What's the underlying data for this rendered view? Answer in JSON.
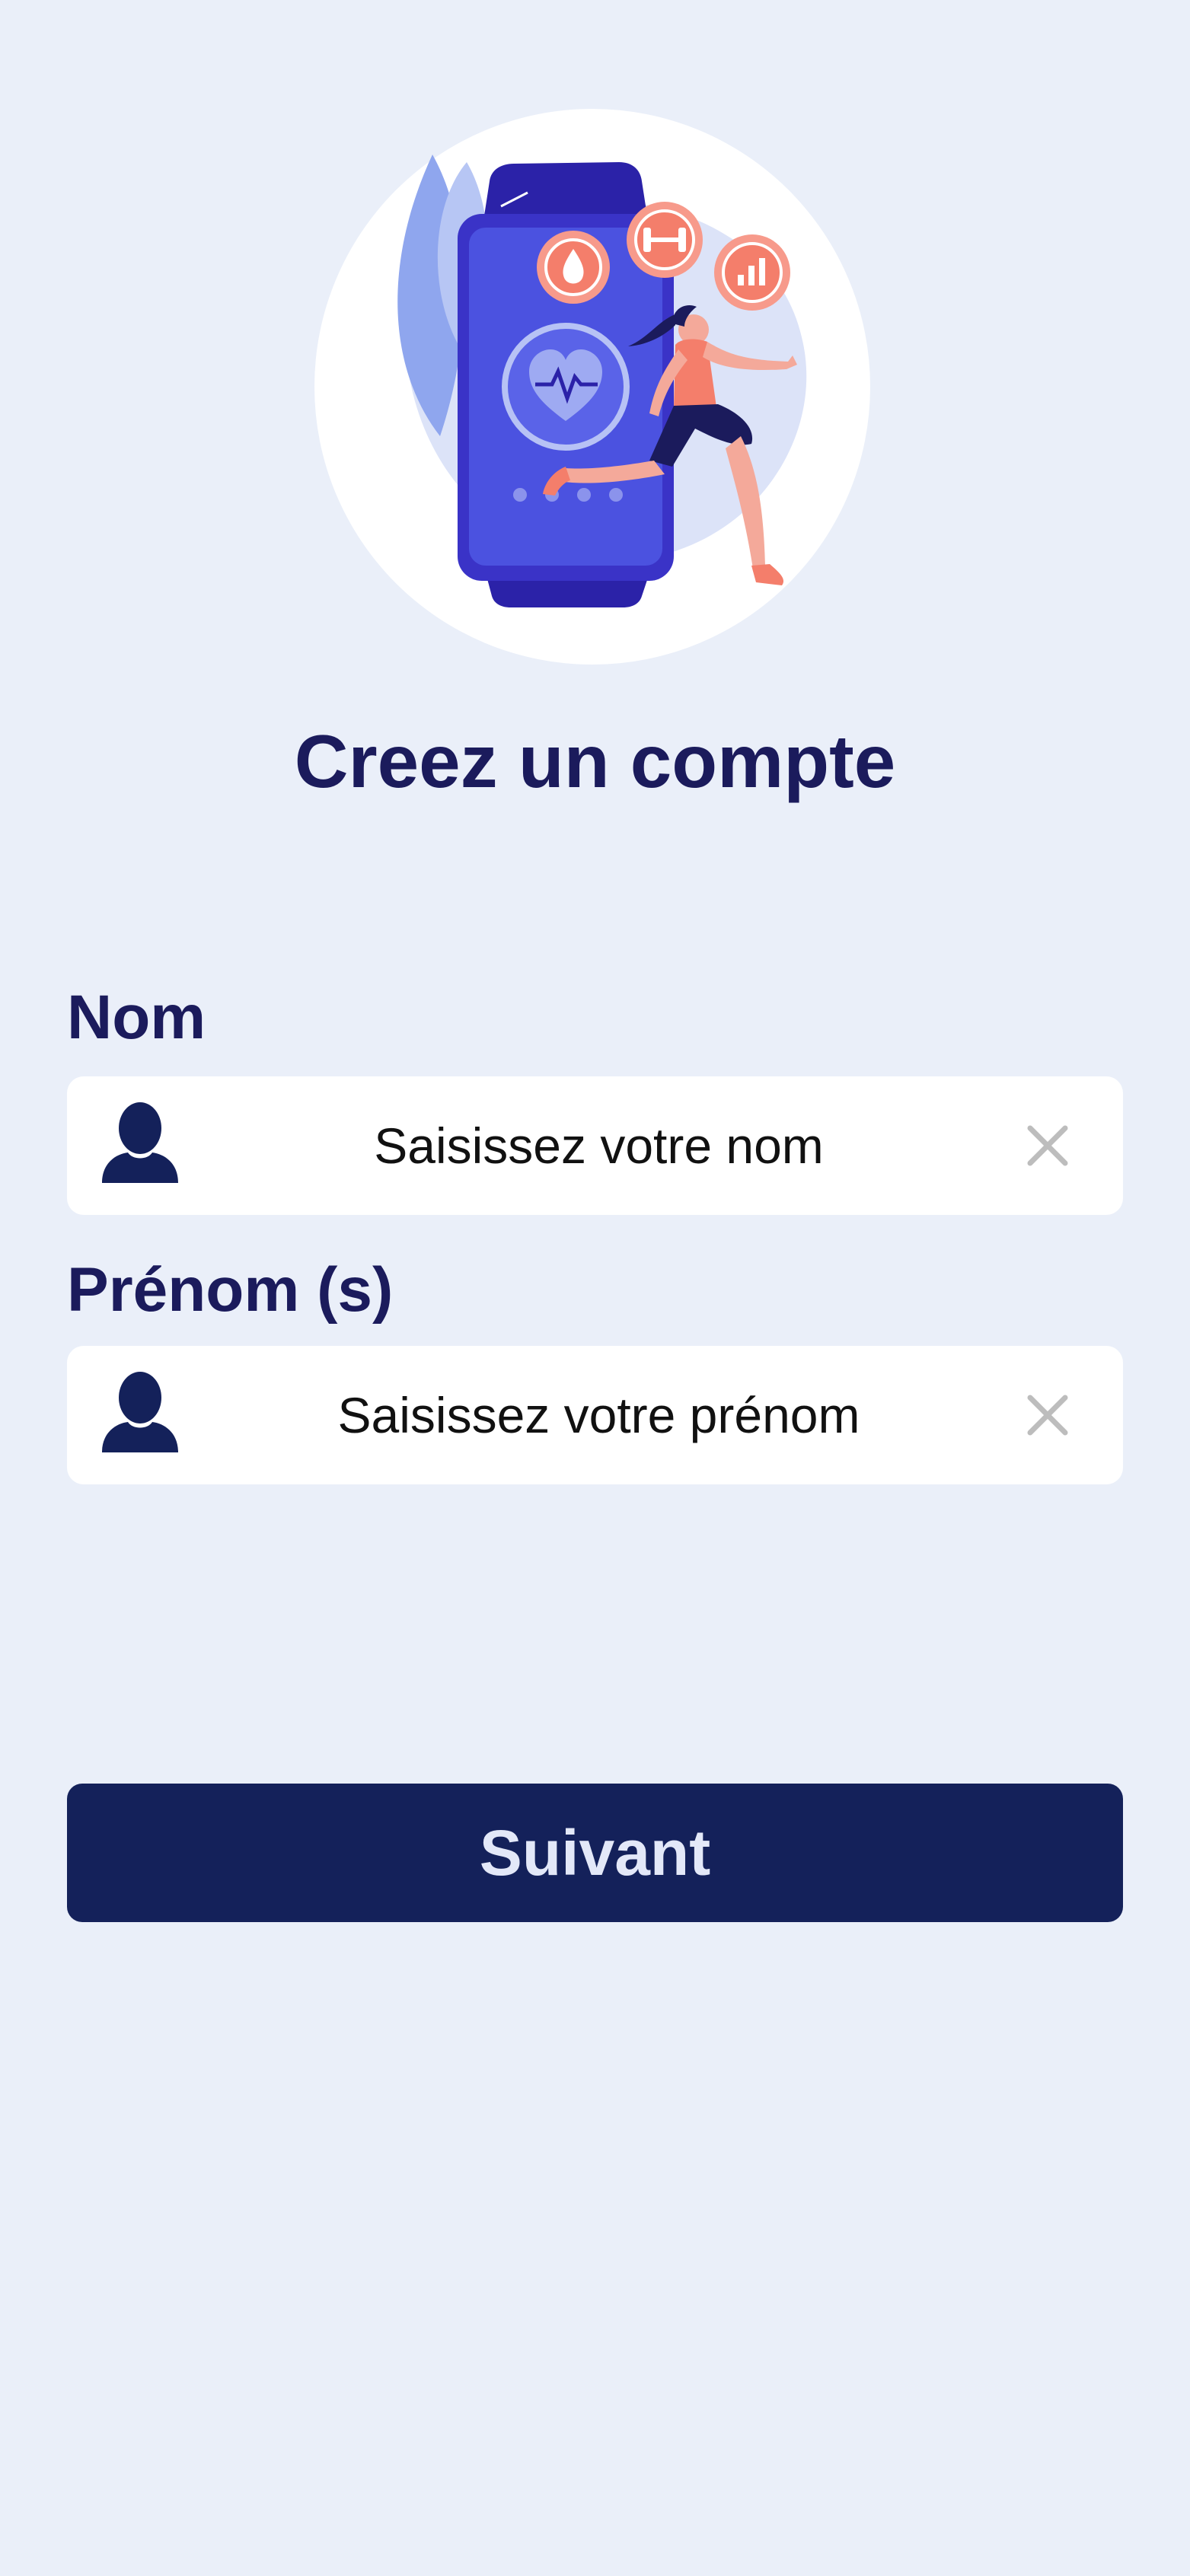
{
  "header": {
    "title": "Creez un compte"
  },
  "hero": {
    "illustration": "smartwatch-fitness-illustration"
  },
  "form": {
    "nom": {
      "label": "Nom",
      "placeholder": "Saisissez votre nom",
      "value": "",
      "icon": "user-icon",
      "clear_icon": "close-icon"
    },
    "prenom": {
      "label": "Prénom (s)",
      "placeholder": "Saisissez votre prénom",
      "value": "",
      "icon": "user-icon",
      "clear_icon": "close-icon"
    }
  },
  "actions": {
    "next_label": "Suivant"
  },
  "colors": {
    "background": "#EAEFF9",
    "primary": "#14215A",
    "title": "#1B1B5C",
    "button_text": "#E3E8F8",
    "accent_blue": "#3B3BD6",
    "accent_coral": "#F47E6B"
  }
}
